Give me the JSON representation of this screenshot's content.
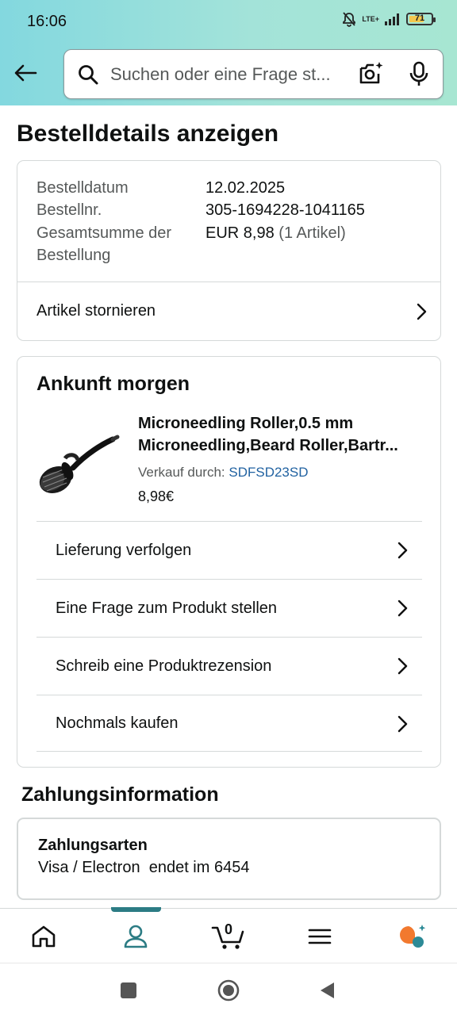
{
  "status_bar": {
    "time": "16:06",
    "network": "LTE+",
    "battery": "71",
    "battery_level": 0.71
  },
  "header": {
    "search": {
      "placeholder": "Suchen oder eine Frage st..."
    },
    "icons": [
      "back-arrow-icon",
      "search-icon",
      "camera-icon",
      "mic-icon"
    ]
  },
  "page": {
    "title": "Bestelldetails anzeigen"
  },
  "summary": {
    "order_date_label": "Bestelldatum",
    "order_date": "12.02.2025",
    "order_number_label": "Bestellnr.",
    "order_number": "305-1694228-1041165",
    "total_label_line1": "Gesamtsumme der",
    "total_label_line2": "Bestellung",
    "total_value": "EUR 8,98",
    "total_items": "(1 Artikel)",
    "cancel_label": "Artikel stornieren"
  },
  "shipment": {
    "status": "Ankunft morgen",
    "product": {
      "title_line1": "Microneedling Roller,0.5 mm",
      "title_line2": "Microneedling,Beard Roller,Bartr...",
      "sold_by_label": "Verkauf durch:",
      "seller": "SDFSD23SD",
      "price": "8,98€"
    },
    "actions": [
      {
        "label": "Lieferung verfolgen"
      },
      {
        "label": "Eine Frage zum Produkt stellen"
      },
      {
        "label": "Schreib eine Produktrezension"
      },
      {
        "label": "Nochmals kaufen"
      }
    ]
  },
  "payment": {
    "section_title": "Zahlungsinformation",
    "methods_label": "Zahlungsarten",
    "method_detail": "Visa / Electron  endet im 6454"
  },
  "bottom_nav": {
    "cart_count": "0",
    "items": [
      "home-icon",
      "account-icon",
      "cart-icon",
      "menu-icon",
      "rufus-icon"
    ],
    "active": "account-icon",
    "accent_color": "#2c7c84"
  },
  "colors": {
    "header_gradient_start": "#83d8df",
    "header_gradient_end": "#a7e6d2",
    "link": "#2162a1",
    "text": "#0f1111",
    "muted": "#565959"
  }
}
